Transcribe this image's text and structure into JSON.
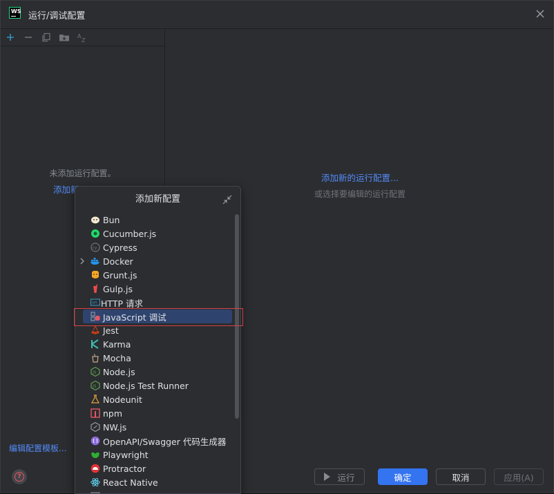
{
  "window": {
    "title": "运行/调试配置"
  },
  "left_pane": {
    "empty_message": "未添加运行配置。",
    "add_new_link": "添加新...",
    "edit_templates_link": "编辑配置模板..."
  },
  "right_pane": {
    "add_new_link": "添加新的运行配置...",
    "hint": "或选择要编辑的运行配置"
  },
  "popup": {
    "title": "添加新配置",
    "items": [
      {
        "label": "Bun",
        "icon": "bun-icon"
      },
      {
        "label": "Cucumber.js",
        "icon": "cucumber-icon"
      },
      {
        "label": "Cypress",
        "icon": "cypress-icon"
      },
      {
        "label": "Docker",
        "icon": "docker-icon",
        "expandable": true
      },
      {
        "label": "Grunt.js",
        "icon": "grunt-icon"
      },
      {
        "label": "Gulp.js",
        "icon": "gulp-icon"
      },
      {
        "label": "HTTP 请求",
        "icon": "http-request-icon"
      },
      {
        "label": "JavaScript 调试",
        "icon": "javascript-debug-icon",
        "selected": true
      },
      {
        "label": "Jest",
        "icon": "jest-icon"
      },
      {
        "label": "Karma",
        "icon": "karma-icon"
      },
      {
        "label": "Mocha",
        "icon": "mocha-icon"
      },
      {
        "label": "Node.js",
        "icon": "nodejs-icon"
      },
      {
        "label": "Node.js Test Runner",
        "icon": "nodejs-test-runner-icon"
      },
      {
        "label": "Nodeunit",
        "icon": "nodeunit-icon"
      },
      {
        "label": "npm",
        "icon": "npm-icon"
      },
      {
        "label": "NW.js",
        "icon": "nwjs-icon"
      },
      {
        "label": "OpenAPI/Swagger 代码生成器",
        "icon": "openapi-icon"
      },
      {
        "label": "Playwright",
        "icon": "playwright-icon"
      },
      {
        "label": "Protractor",
        "icon": "protractor-icon"
      },
      {
        "label": "React Native",
        "icon": "react-native-icon"
      }
    ]
  },
  "buttons": {
    "run": "运行",
    "ok": "确定",
    "cancel": "取消",
    "apply": "应用(A)"
  },
  "colors": {
    "background": "#2b2d30",
    "link": "#548af7",
    "primary_button": "#3574f0",
    "selection": "#2e436e",
    "highlight_box": "#d9424a"
  }
}
